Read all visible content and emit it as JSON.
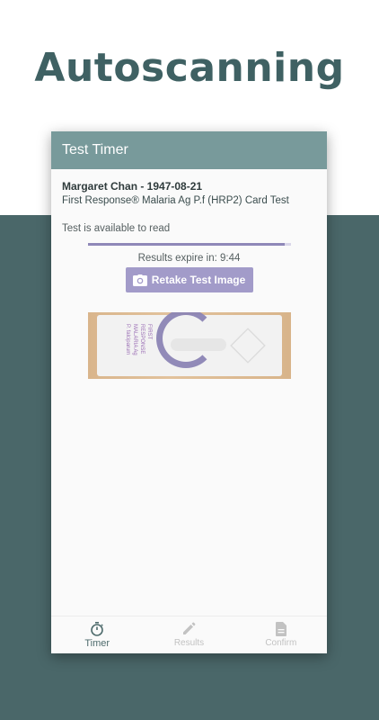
{
  "headline": "Autoscanning",
  "app_bar": {
    "title": "Test Timer"
  },
  "patient": {
    "name_dob": "Margaret Chan - 1947-08-21"
  },
  "test": {
    "name": "First Response® Malaria Ag P.f (HRP2) Card Test"
  },
  "status": {
    "message": "Test is available to read",
    "progress_fraction": 0.97
  },
  "expiry": {
    "text": "Results expire in: 9:44"
  },
  "retake_button": {
    "label": "Retake Test Image",
    "icon": "camera-icon"
  },
  "test_image": {
    "label_lines": [
      "FIRST",
      "RESPONSE",
      "MALARIA Ag",
      "P. falciparum"
    ]
  },
  "bottom_nav": {
    "items": [
      {
        "label": "Timer",
        "icon": "stopwatch-icon",
        "active": true
      },
      {
        "label": "Results",
        "icon": "pencil-icon",
        "active": false
      },
      {
        "label": "Confirm",
        "icon": "document-icon",
        "active": false
      }
    ]
  },
  "colors": {
    "app_bar": "#789a9b",
    "background_band": "#4a6769",
    "accent_purple": "#a29bc9",
    "active_nav": "#4e6b6c"
  }
}
